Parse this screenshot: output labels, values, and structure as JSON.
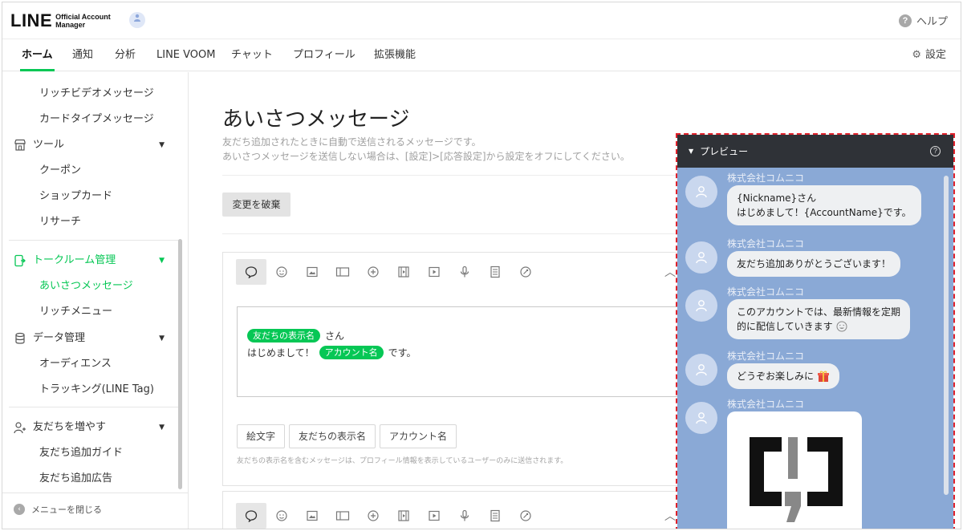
{
  "header": {
    "logo_main": "LINE",
    "logo_sub_1": "Official Account",
    "logo_sub_2": "Manager",
    "help_label": "ヘルプ"
  },
  "nav": {
    "tabs": [
      "ホーム",
      "通知",
      "分析",
      "LINE VOOM",
      "チャット",
      "プロフィール",
      "拡張機能"
    ],
    "settings_label": "設定"
  },
  "sidebar": {
    "items": [
      {
        "label": "リッチビデオメッセージ"
      },
      {
        "label": "カードタイプメッセージ"
      },
      {
        "label": "ツール"
      },
      {
        "label": "クーポン"
      },
      {
        "label": "ショップカード"
      },
      {
        "label": "リサーチ"
      },
      {
        "label": "トークルーム管理"
      },
      {
        "label": "あいさつメッセージ"
      },
      {
        "label": "リッチメニュー"
      },
      {
        "label": "データ管理"
      },
      {
        "label": "オーディエンス"
      },
      {
        "label": "トラッキング(LINE Tag)"
      },
      {
        "label": "友だちを増やす"
      },
      {
        "label": "友だち追加ガイド"
      },
      {
        "label": "友だち追加広告"
      }
    ],
    "close_menu": "メニューを閉じる"
  },
  "main": {
    "title": "あいさつメッセージ",
    "desc1": "友だち追加されたときに自動で送信されるメッセージです。",
    "desc2": "あいさつメッセージを送信しない場合は、[設定]>[応答設定]から設定をオフにしてください。",
    "discard_label": "変更を破棄",
    "message": {
      "tag_friend": "友だちの表示名",
      "after_friend": "さん",
      "before_account": "はじめまして！",
      "tag_account": "アカウント名",
      "after_account": "です。"
    },
    "insert_buttons": [
      "絵文字",
      "友だちの表示名",
      "アカウント名"
    ],
    "note": "友だちの表示名を含むメッセージは、プロフィール情報を表示しているユーザーのみに送信されます。"
  },
  "preview": {
    "title": "プレビュー",
    "help": "?",
    "sender": "株式会社コムニコ",
    "messages": [
      {
        "line1": "{Nickname}さん",
        "line2": "はじめまして！{AccountName}です。"
      },
      {
        "line1": "友だち追加ありがとうございます！"
      },
      {
        "line1": "このアカウントでは、最新情報を定期",
        "line2": "的に配信していきます"
      },
      {
        "line1": "どうぞお楽しみに"
      }
    ]
  },
  "colors": {
    "accent": "#06c755",
    "preview_bg": "#8aa9d6",
    "preview_header": "#2f3237",
    "highlight_border": "#e0212b"
  }
}
